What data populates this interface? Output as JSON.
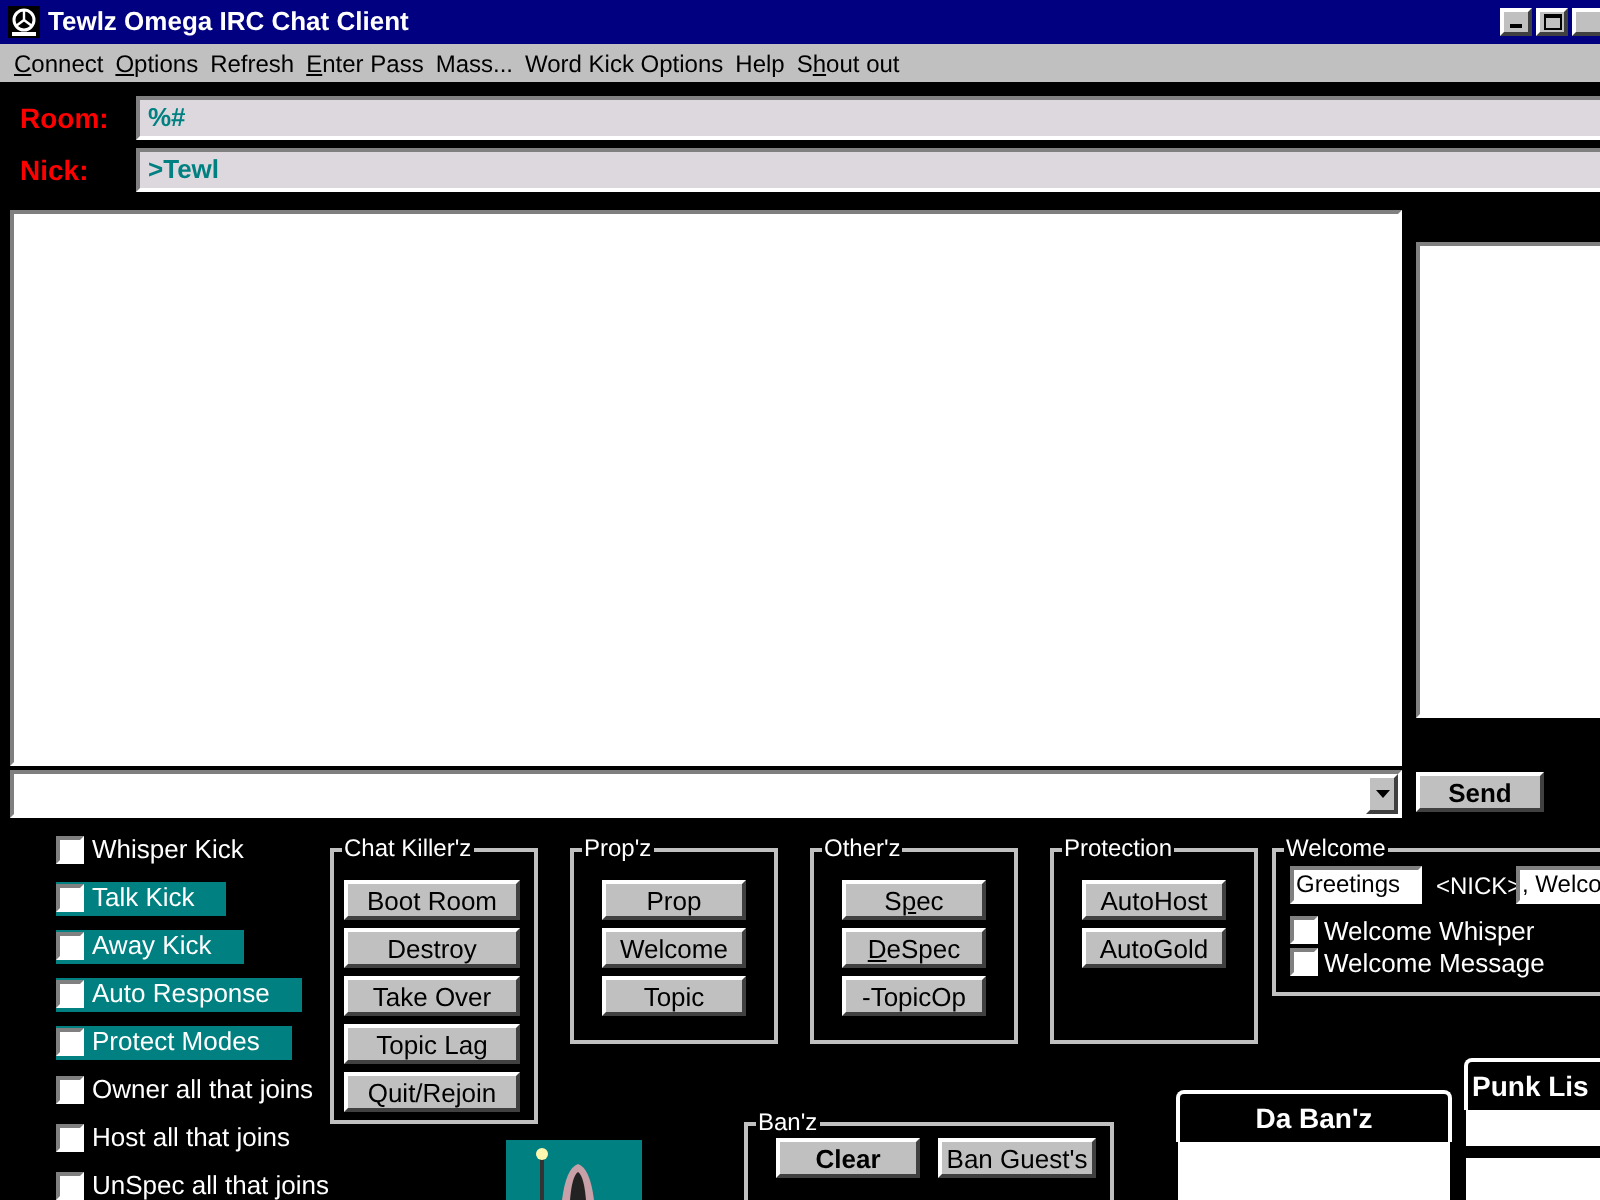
{
  "window": {
    "title": "Tewlz Omega IRC Chat Client"
  },
  "menu": [
    {
      "key": "C",
      "after": "onnect"
    },
    {
      "key": "O",
      "after": "ptions"
    },
    {
      "before": "Refresh"
    },
    {
      "key": "E",
      "after": "nter Pass"
    },
    {
      "before": "Mass..."
    },
    {
      "before": "Word Kick Options"
    },
    {
      "before": "Help"
    },
    {
      "before": "S",
      "key": "h",
      "after": "out out"
    }
  ],
  "room": {
    "label": "Room:",
    "value": "%#"
  },
  "nick": {
    "label": "Nick:",
    "value": ">Tewl"
  },
  "send_button": "Send",
  "options": [
    {
      "label": "Whisper Kick",
      "checked": false,
      "highlighted": false
    },
    {
      "label": "Talk Kick",
      "checked": false,
      "highlighted": true
    },
    {
      "label": "Away Kick",
      "checked": false,
      "highlighted": true
    },
    {
      "label": "Auto Response",
      "checked": false,
      "highlighted": true
    },
    {
      "label": "Protect Modes",
      "checked": false,
      "highlighted": true
    },
    {
      "label": "Owner all that joins",
      "checked": false,
      "highlighted": false
    },
    {
      "label": "Host all that joins",
      "checked": false,
      "highlighted": false
    },
    {
      "label": "UnSpec all that joins",
      "checked": false,
      "highlighted": false
    }
  ],
  "groups": [
    {
      "title": "Chat Killer'z",
      "buttons": [
        {
          "before": "Boot Room"
        },
        {
          "before": "Destroy"
        },
        {
          "before": "Take Over"
        },
        {
          "before": "Topic Lag"
        },
        {
          "before": "Quit/Rejoin"
        }
      ]
    },
    {
      "title": "Prop'z",
      "buttons": [
        {
          "before": "Prop"
        },
        {
          "before": "Welcome"
        },
        {
          "before": "Topic"
        }
      ]
    },
    {
      "title": "Other'z",
      "buttons": [
        {
          "before": "S",
          "key": "p",
          "after": "ec"
        },
        {
          "key": "D",
          "after": "eSpec"
        },
        {
          "before": "-TopicOp"
        }
      ]
    },
    {
      "title": "Protection",
      "buttons": [
        {
          "before": "AutoHost"
        },
        {
          "before": "AutoGold"
        }
      ]
    }
  ],
  "welcome": {
    "title": "Welcome",
    "greeting": "Greetings",
    "nick_token": "<NICK>",
    "message": ", Welco",
    "options": [
      {
        "label": "Welcome Whisper",
        "checked": false
      },
      {
        "label": "Welcome Message",
        "checked": false
      }
    ]
  },
  "bans": {
    "title": "Ban'z",
    "buttons": [
      {
        "label": "Clear",
        "bold": true
      },
      {
        "label": "Ban Guest's",
        "bold": false
      }
    ]
  },
  "ban_list": {
    "title": "Da Ban'z"
  },
  "punk_list": {
    "title": "Punk Lis"
  }
}
